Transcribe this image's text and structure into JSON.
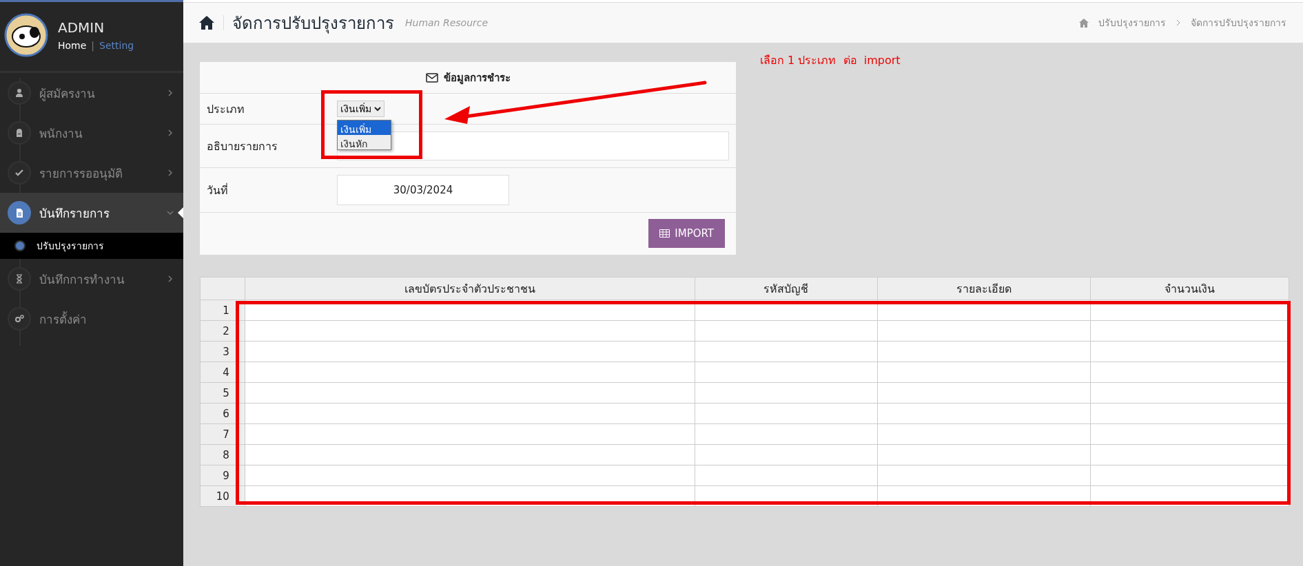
{
  "sidebar": {
    "profile": {
      "name": "ADMIN",
      "links": [
        "Home",
        "Setting"
      ],
      "separator": "|"
    },
    "items": [
      {
        "label": "ผู้สมัครงาน",
        "selected": false,
        "expanded": false
      },
      {
        "label": "พนักงาน",
        "selected": false,
        "expanded": false
      },
      {
        "label": "รายการรออนุมัติ",
        "selected": false,
        "expanded": false
      },
      {
        "label": "บันทึกรายการ",
        "selected": true,
        "expanded": true,
        "children": [
          {
            "label": "ปรับปรุงรายการ",
            "selected": true
          }
        ]
      },
      {
        "label": "บันทึกการทำงาน",
        "selected": false,
        "expanded": false
      },
      {
        "label": "การตั้งค่า",
        "selected": false
      }
    ]
  },
  "header": {
    "title": "จัดการปรับปรุงรายการ",
    "subtitle": "Human Resource",
    "breadcrumb": [
      "ปรับปรุงรายการ",
      "จัดการปรับปรุงรายการ"
    ]
  },
  "annotation": {
    "note": "เลือก 1 ประเภท  ต่อ  import"
  },
  "form": {
    "title": "ข้อมูลการชำระ",
    "type": {
      "label": "ประเภท",
      "value": "เงินเพิ่ม",
      "options": [
        {
          "label": "เงินเพิ่ม",
          "selected": true
        },
        {
          "label": "เงินหัก",
          "selected": false
        }
      ]
    },
    "description": {
      "label": "อธิบายรายการ"
    },
    "date": {
      "label": "วันที่",
      "value": "30/03/2024"
    },
    "import_button": "IMPORT"
  },
  "table": {
    "columns": [
      "เลขบัตรประจำตัวประชาชน",
      "รหัสบัญชี",
      "รายละเอียด",
      "จำนวนเงิน"
    ],
    "row_numbers": [
      "1",
      "2",
      "3",
      "4",
      "5",
      "6",
      "7",
      "8",
      "9",
      "10"
    ]
  }
}
